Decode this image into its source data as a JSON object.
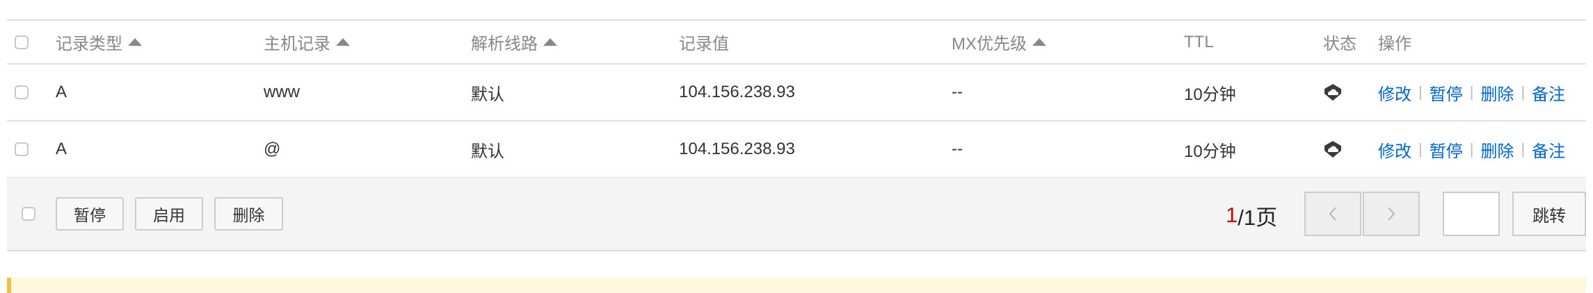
{
  "table": {
    "headers": {
      "type": "记录类型",
      "host": "主机记录",
      "line": "解析线路",
      "value": "记录值",
      "mx": "MX优先级",
      "ttl": "TTL",
      "status": "状态",
      "ops": "操作"
    },
    "rows": [
      {
        "type": "A",
        "host": "www",
        "line": "默认",
        "value": "104.156.238.93",
        "mx": "--",
        "ttl": "10分钟",
        "status_icon": "cloud-status-icon",
        "ops": {
          "edit": "修改",
          "pause": "暂停",
          "delete": "删除",
          "note": "备注"
        }
      },
      {
        "type": "A",
        "host": "@",
        "line": "默认",
        "value": "104.156.238.93",
        "mx": "--",
        "ttl": "10分钟",
        "status_icon": "cloud-status-icon",
        "ops": {
          "edit": "修改",
          "pause": "暂停",
          "delete": "删除",
          "note": "备注"
        }
      }
    ]
  },
  "footer": {
    "pause_label": "暂停",
    "enable_label": "启用",
    "delete_label": "删除",
    "current_page": "1",
    "total_pages_text": "/1页",
    "prev_icon": "chevron-left-icon",
    "next_icon": "chevron-right-icon",
    "page_input_value": "",
    "jump_label": "跳转"
  },
  "colors": {
    "link": "#0066cc",
    "current_page": "#cc0000",
    "notice_bg": "#fdf7dd",
    "notice_border": "#f0c040"
  }
}
